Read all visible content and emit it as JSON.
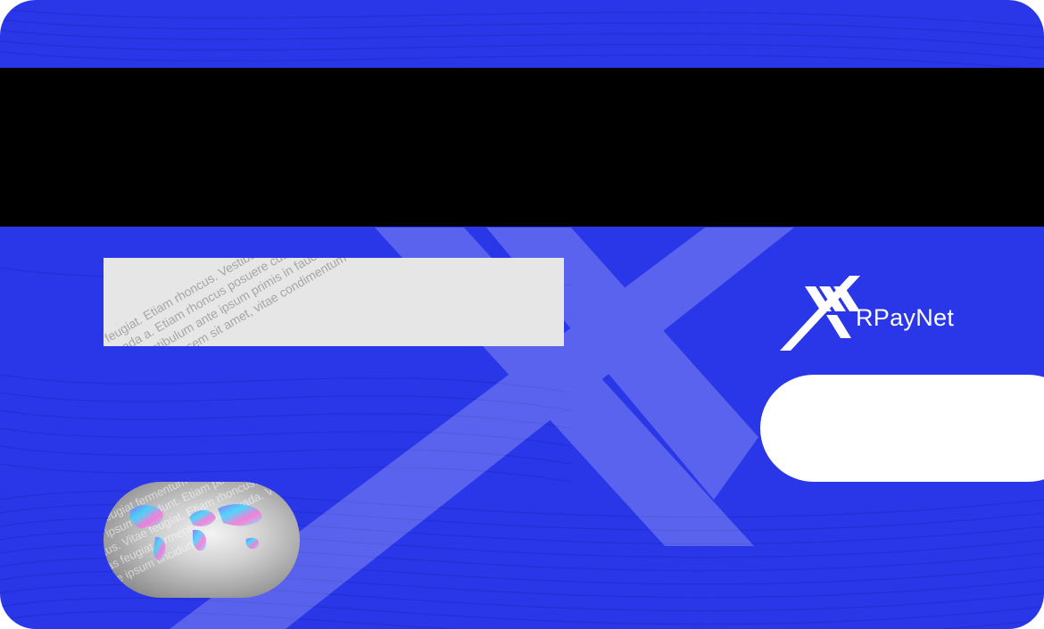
{
  "card": {
    "brand_name": "RPayNet",
    "colors": {
      "card_background": "#2a37e8",
      "magnetic_stripe": "#000000",
      "signature_panel": "#e6e6e6",
      "cvv_box": "#ffffff",
      "logo": "#ffffff"
    },
    "signature_panel_pattern": "Cras feugiat. Etiam rhoncus. Vestibulum tincidunt. Mauris id lacus fermentum sem sit amet, vitae condimentum malesuada a. Etiam rhoncus posuere cubilia Curae; primis in faucibus orci luctus et ultrices posuere massa, quis eleifend. Vestibulum ante ipsum primis in faucibus. Cras feugiat. Etiam rhoncus. Vestibulum tincidunt. Mauris id lacus fermentum sem sit amet, vitae condimentum malesuada a. Etiam rhoncus.",
    "hologram_pattern": "Cras feugiat fermentum malesuada. Vestibulum ante ipsum tincidunt. Etiam posuere cubilia orci luctus. Vitae feugiat. Etiam rhoncus. Vestibulum. Cras feugiat fermentum malesuada. Vestibulum ante ipsum tincidunt."
  }
}
